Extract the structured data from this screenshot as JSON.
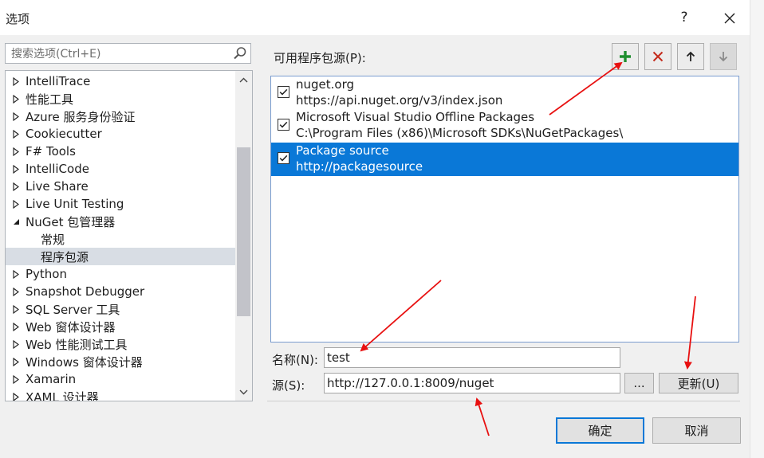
{
  "dialog": {
    "title": "选项",
    "help_label": "?",
    "ok_label": "确定",
    "cancel_label": "取消"
  },
  "search": {
    "placeholder": "搜索选项(Ctrl+E)"
  },
  "tree": {
    "items": [
      {
        "label": "IntelliTrace",
        "expanded": false
      },
      {
        "label": "性能工具",
        "expanded": false
      },
      {
        "label": "Azure 服务身份验证",
        "expanded": false
      },
      {
        "label": "Cookiecutter",
        "expanded": false
      },
      {
        "label": "F# Tools",
        "expanded": false
      },
      {
        "label": "IntelliCode",
        "expanded": false
      },
      {
        "label": "Live Share",
        "expanded": false
      },
      {
        "label": "Live Unit Testing",
        "expanded": false
      },
      {
        "label": "NuGet 包管理器",
        "expanded": true
      },
      {
        "label": "常规",
        "child": true
      },
      {
        "label": "程序包源",
        "child": true,
        "selected": true
      },
      {
        "label": "Python",
        "expanded": false
      },
      {
        "label": "Snapshot Debugger",
        "expanded": false
      },
      {
        "label": "SQL Server 工具",
        "expanded": false
      },
      {
        "label": "Web 窗体设计器",
        "expanded": false
      },
      {
        "label": "Web 性能测试工具",
        "expanded": false
      },
      {
        "label": "Windows 窗体设计器",
        "expanded": false
      },
      {
        "label": "Xamarin",
        "expanded": false
      },
      {
        "label": "XAML 设计器",
        "expanded": false
      }
    ]
  },
  "sources": {
    "label": "可用程序包源(P):",
    "items": [
      {
        "name": "nuget.org",
        "url": "https://api.nuget.org/v3/index.json",
        "checked": true,
        "selected": false
      },
      {
        "name": "Microsoft Visual Studio Offline Packages",
        "url": "C:\\Program Files (x86)\\Microsoft SDKs\\NuGetPackages\\",
        "checked": true,
        "selected": false
      },
      {
        "name": "Package source",
        "url": "http://packagesource",
        "checked": true,
        "selected": true
      }
    ]
  },
  "form": {
    "name_label": "名称(N):",
    "name_value": "test",
    "source_label": "源(S):",
    "source_value": "http://127.0.0.1:8009/nuget",
    "browse_label": "...",
    "update_label": "更新(U)"
  },
  "colors": {
    "selection": "#0a78d7",
    "add_icon": "#1e8e2e",
    "remove_icon": "#c42b1c",
    "annotation_arrow": "#e81010"
  }
}
